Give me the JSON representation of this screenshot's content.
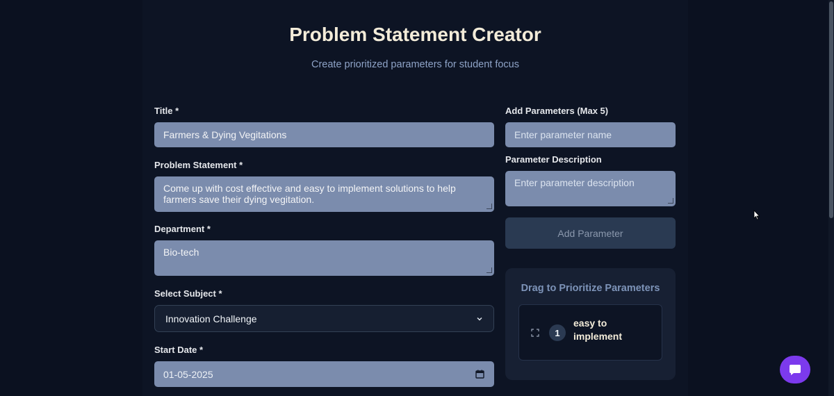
{
  "header": {
    "title": "Problem Statement Creator",
    "subtitle": "Create prioritized parameters for student focus"
  },
  "form": {
    "title_label": "Title *",
    "title_value": "Farmers & Dying Vegitations",
    "statement_label": "Problem Statement *",
    "statement_value": "Come up with cost effective and easy to implement solutions to help farmers save their dying vegitation.",
    "department_label": "Department *",
    "department_value": "Bio-tech",
    "subject_label": "Select Subject *",
    "subject_selected": "Innovation Challenge",
    "start_date_label": "Start Date *",
    "start_date_value": "01-05-2025"
  },
  "parameters": {
    "add_label": "Add Parameters (Max 5)",
    "name_placeholder": "Enter parameter name",
    "description_label": "Parameter Description",
    "description_placeholder": "Enter parameter description",
    "add_button_label": "Add Parameter",
    "prioritize_title": "Drag to Prioritize Parameters",
    "items": [
      {
        "rank": "1",
        "name": "easy to implement"
      }
    ]
  },
  "colors": {
    "background": "#0b1120",
    "field": "#7b8cad",
    "accent_chat": "#7c3aed",
    "title": "#f3ecd9"
  },
  "icons": {
    "select": "chevron-down-icon",
    "date": "calendar-icon",
    "drag": "drag-handle-icon",
    "chat": "chat-icon"
  }
}
